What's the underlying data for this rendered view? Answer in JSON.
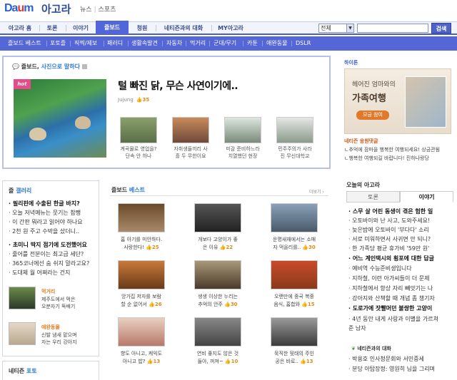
{
  "header": {
    "logo": "Daum",
    "title": "아고라",
    "links": [
      "뉴스",
      "스포츠"
    ]
  },
  "nav": {
    "tabs": [
      "아고라 홈",
      "토론",
      "이야기",
      "즐보드",
      "청원",
      "네티즌과의 대화",
      "MY아고라"
    ],
    "active": "즐보드",
    "search_select": "전체",
    "search_button": "검색"
  },
  "subnav": [
    "즐보드 베스트",
    "포토즐",
    "직찍/제보",
    "패러디",
    "생활속발견",
    "자동차",
    "먹거리",
    "군대/무기",
    "카툰",
    "애완동물",
    "DSLR"
  ],
  "featured": {
    "heading_prefix": "즐보드,",
    "heading_highlight": "사진으로 말하다",
    "badge": "hot",
    "title": "털 빠진 닭, 무슨 사연이기에..",
    "author": "Jujung",
    "recommend": "35",
    "thumbs": [
      {
        "caption1": "계곡물로 영업을?",
        "caption2": "단속 안 하나"
      },
      {
        "caption1": "자취생들끼리 사",
        "caption2": "흘 두 무한이요"
      },
      {
        "caption1": "미감 준비하느라",
        "caption2": "치열했던 현장"
      },
      {
        "caption1": "민주주의가 사라",
        "caption2": "진 무신대학교"
      }
    ]
  },
  "ad": {
    "logo": "하이톤",
    "line1": "헤어진 엄마와의",
    "line2": "가족여행",
    "button": "모금 참여",
    "title": "네티즌 응원댓글",
    "comments": [
      "ㄴ추억에 잠마을 행복한 여행되세요! 상금관됨",
      "ㄴ행복한 여행되길 바랍니다! 진하나랑당"
    ]
  },
  "gallery": {
    "heading_prefix": "즐",
    "heading_highlight": "갤러리",
    "lines": [
      {
        "text": "· 필리핀에 수출된 한글 바지?",
        "bold": true
      },
      {
        "text": "· 오늘 저녁메뉴는 뭇기는 참쨍",
        "bold": false
      },
      {
        "text": "· 이 간판 뭐라고 읽어야 하나요",
        "bold": false
      },
      {
        "text": "· 2천 원 주고 수박을 샀더니..",
        "bold": false
      },
      {
        "text": "· 초미니 딱지 점기에 도전했어요",
        "bold": true
      },
      {
        "text": "· 줄어를 전분이는 최고급 세단?",
        "bold": false
      },
      {
        "text": "· 365코너에선 숨 쉬지 말라고요?",
        "bold": false
      },
      {
        "text": "· 도대체 월 어쩌라는 건지",
        "bold": false
      }
    ],
    "items": [
      {
        "title": "먹거리",
        "desc1": "제주도에서 먹은",
        "desc2": "오분자기 뚝배기"
      },
      {
        "title": "애완동물",
        "desc1": "신발 냄새 맡으며",
        "desc2": "자는 우리 강아지"
      }
    ],
    "netizen_prefix": "네티즌",
    "netizen_highlight": "포토"
  },
  "best": {
    "heading_prefix": "즐보드",
    "heading_highlight": "베스트",
    "more": "더보기 ›",
    "items": [
      {
        "c1": "홈 아기를 미안하다.",
        "c2": "사랑한다!",
        "n": "25"
      },
      {
        "c1": "개보다 고양이가 좋",
        "c2": "은 이유",
        "n": "22"
      },
      {
        "c1": "운명새재에서는 소매",
        "c2": "자 먹을리를..",
        "n": "30"
      },
      {
        "c1": "앙가집 저자를 보람",
        "c2": "할 순 없어서",
        "n": "26"
      },
      {
        "c1": "생생 이상한 누리는",
        "c2": "추억의 안주",
        "n": "30"
      },
      {
        "c1": "오랜만에 중국 복중",
        "c2": "음식, 홈합와",
        "n": "15"
      },
      {
        "c1": "향도 아니고, 케익도",
        "c2": "아니고 밥?",
        "n": "13"
      },
      {
        "c1": "연비 좋지도 않은 것",
        "c2": "들아, 꺼져~",
        "n": "10"
      },
      {
        "c1": "묵직한 뒷태의 주인",
        "c2": "공은 바로..",
        "n": "13"
      }
    ]
  },
  "today": {
    "heading": "오늘의 아고라",
    "tabs": [
      "토론",
      "이야기"
    ],
    "active_tab": "이야기",
    "lines": [
      {
        "text": "· 스무 살 어린 동생이 겪은 험한 일",
        "bold": true
      },
      {
        "text": "· 오토바이와 난 사고, 도와주세요!",
        "bold": false
      },
      {
        "text": "· 늦은밤에 오토바이 '부다다' 소리",
        "bold": false
      },
      {
        "text": "· 서로 미워하면서 사귀면 안 되니?",
        "bold": false
      },
      {
        "text": "· 한 가족당 평균 휴가비 '59만 원'",
        "bold": false
      },
      {
        "text": "· 어느 계인택시의 횡포에 대한 답글",
        "bold": true
      },
      {
        "text": "· 예비역 수능준비생입니다",
        "bold": false
      },
      {
        "text": "· 지하철, 이런 아가씨들이 더 문제",
        "bold": false
      },
      {
        "text": "· 지하철에서 항상 자리 빼앗기는 나",
        "bold": false
      },
      {
        "text": "· 강아지와 산책할 때 개념 좀 챙기자",
        "bold": false
      },
      {
        "text": "· 도로가에 잣빨머던 불쌍한 고양이",
        "bold": true
      },
      {
        "text": "· 4년 동안 내게 사랑과 이별을 가르쳐",
        "bold": false
      },
      {
        "text": "  준 남자",
        "bold": false
      }
    ],
    "talk_heading": "네티즌과의 대화",
    "talk_lines": [
      "· 박용호 인사청문회와 서민증세",
      "· 분당 아탑장정: 영원히 님을 그리며"
    ]
  },
  "colors": {
    "accent": "#5166d8",
    "link_blue": "#2e7bd4",
    "recommend": "#e08a1a"
  }
}
